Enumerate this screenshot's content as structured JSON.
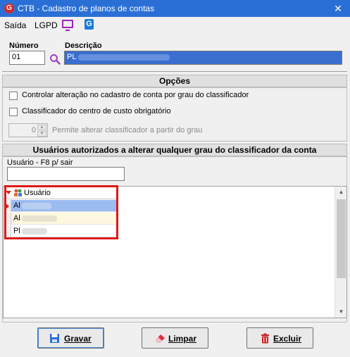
{
  "window": {
    "title": "CTB - Cadastro de planos de contas",
    "close": "✕"
  },
  "menu": {
    "saida": "Saída",
    "lgpd": "LGPD"
  },
  "form": {
    "numero_label": "Número",
    "numero_value": "01",
    "descricao_label": "Descrição",
    "descricao_value": "PL"
  },
  "opcoes": {
    "header": "Opções",
    "check1": "Controlar alteração no cadastro de conta por grau do classificador",
    "check2": "Classificador do centro de custo obrigatório",
    "spin_value": "0",
    "spin_label": "Permite alterar classificador a partir do grau"
  },
  "usuarios": {
    "header": "Usuários autorizados a alterar qualquer grau do classificador da conta",
    "filter_label": "Usuário - F8 p/ sair",
    "filter_value": "",
    "column": "Usuário",
    "rows": [
      "Al",
      "Al",
      "Pl"
    ]
  },
  "buttons": {
    "gravar": "Gravar",
    "limpar": "Limpar",
    "excluir": "Excluir"
  },
  "colors": {
    "titlebar": "#2a6fd6",
    "selected_row": "#9bbcf0",
    "highlight": "#e01818"
  }
}
